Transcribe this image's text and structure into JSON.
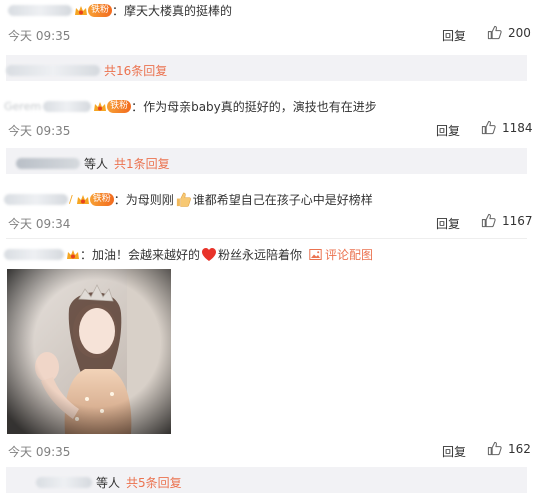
{
  "comments": [
    {
      "text": "：摩天大楼真的挺棒的",
      "fan_badge": "铁粉",
      "time": "今天 09:35",
      "reply_label": "回复",
      "likes": "200",
      "sub": {
        "link_text": "共16条回复"
      }
    },
    {
      "name_fragment": "Gerem",
      "text": "：作为母亲baby真的挺好的，演技也有在进步",
      "fan_badge": "铁粉",
      "time": "今天 09:35",
      "reply_label": "回复",
      "likes": "1184",
      "sub": {
        "suffix": "等人",
        "link_text": "共1条回复"
      }
    },
    {
      "text_before": "：为母则刚",
      "text_after": "谁都希望自己在孩子心中是好榜样",
      "fan_badge": "铁粉",
      "time": "今天 09:34",
      "reply_label": "回复",
      "likes": "1167"
    },
    {
      "text_before": "：加油！会越来越好的",
      "text_after": "粉丝永远陪着你",
      "pic_link": "评论配图",
      "time": "今天 09:35",
      "reply_label": "回复",
      "likes": "162",
      "sub": {
        "suffix": "等人",
        "link_text": "共5条回复"
      }
    }
  ],
  "colors": {
    "link": "#eb7350",
    "time": "#808080",
    "sub_bg": "#f2f2f5",
    "badge": "#f26a1f"
  },
  "icons": [
    "crown-icon",
    "thumbs-up-icon",
    "thumbs-up-emoji-icon",
    "heart-emoji-icon",
    "image-icon"
  ]
}
